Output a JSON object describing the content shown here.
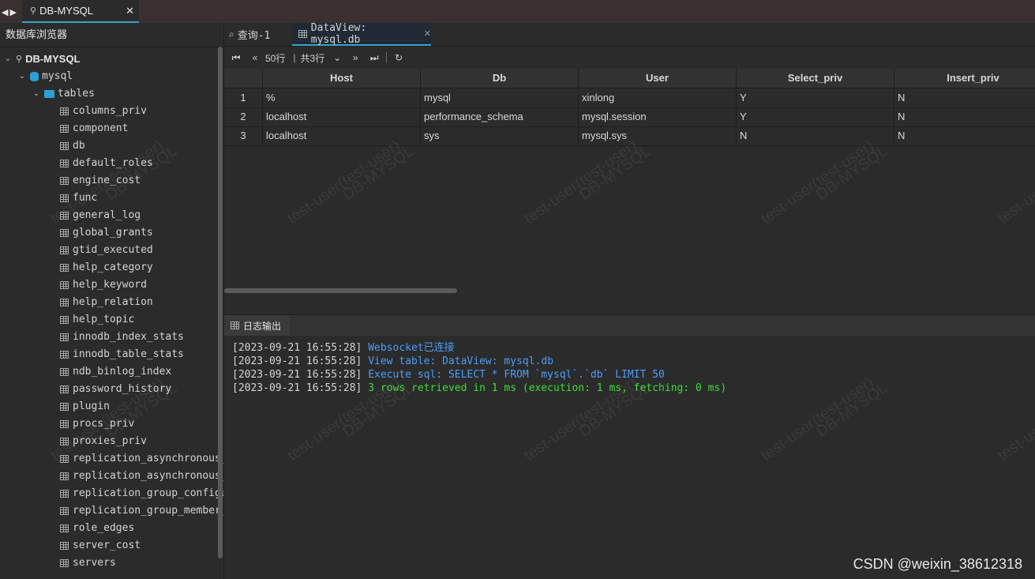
{
  "window": {
    "tab_title": "DB-MYSQL"
  },
  "sidebar": {
    "title": "数据库浏览器",
    "connection": "DB-MYSQL",
    "database": "mysql",
    "folder": "tables",
    "tables": [
      "columns_priv",
      "component",
      "db",
      "default_roles",
      "engine_cost",
      "func",
      "general_log",
      "global_grants",
      "gtid_executed",
      "help_category",
      "help_keyword",
      "help_relation",
      "help_topic",
      "innodb_index_stats",
      "innodb_table_stats",
      "ndb_binlog_index",
      "password_history",
      "plugin",
      "procs_priv",
      "proxies_priv",
      "replication_asynchronous_c",
      "replication_asynchronous_c",
      "replication_group_configur",
      "replication_group_member_c",
      "role_edges",
      "server_cost",
      "servers"
    ]
  },
  "editor_tabs": {
    "query": "查询-1",
    "dataview": "DataView: mysql.db"
  },
  "toolbar": {
    "page_size": "50行",
    "sep": "|",
    "total": "共3行"
  },
  "grid": {
    "columns": [
      "Host",
      "Db",
      "User",
      "Select_priv",
      "Insert_priv"
    ],
    "rows": [
      [
        "1",
        "%",
        "mysql",
        "xinlong",
        "Y",
        "N"
      ],
      [
        "2",
        "localhost",
        "performance_schema",
        "mysql.session",
        "Y",
        "N"
      ],
      [
        "3",
        "localhost",
        "sys",
        "mysql.sys",
        "N",
        "N"
      ]
    ]
  },
  "log": {
    "tab_label": "日志输出",
    "lines": [
      {
        "ts": "[2023-09-21 16:55:28]",
        "msg": "Websocket已连接",
        "color": "#4a9df8"
      },
      {
        "ts": "[2023-09-21 16:55:28]",
        "msg": "View table: DataView: mysql.db",
        "color": "#4a9df8"
      },
      {
        "ts": "[2023-09-21 16:55:28]",
        "msg": "Execute sql: SELECT * FROM `mysql`.`db` LIMIT 50",
        "color": "#4a9df8"
      },
      {
        "ts": "[2023-09-21 16:55:28]",
        "msg": "3 rows retrieved in 1 ms (execution: 1 ms, fetching: 0 ms)",
        "color": "#3ddc3d"
      }
    ]
  },
  "watermark": {
    "user": "test-user(test-user)",
    "conn": "DB-MYSQL"
  },
  "footer": {
    "credit": "CSDN @weixin_38612318"
  },
  "colors": {
    "accent": "#3aa3c9",
    "log_info": "#4a9df8",
    "log_success": "#3ddc3d"
  }
}
